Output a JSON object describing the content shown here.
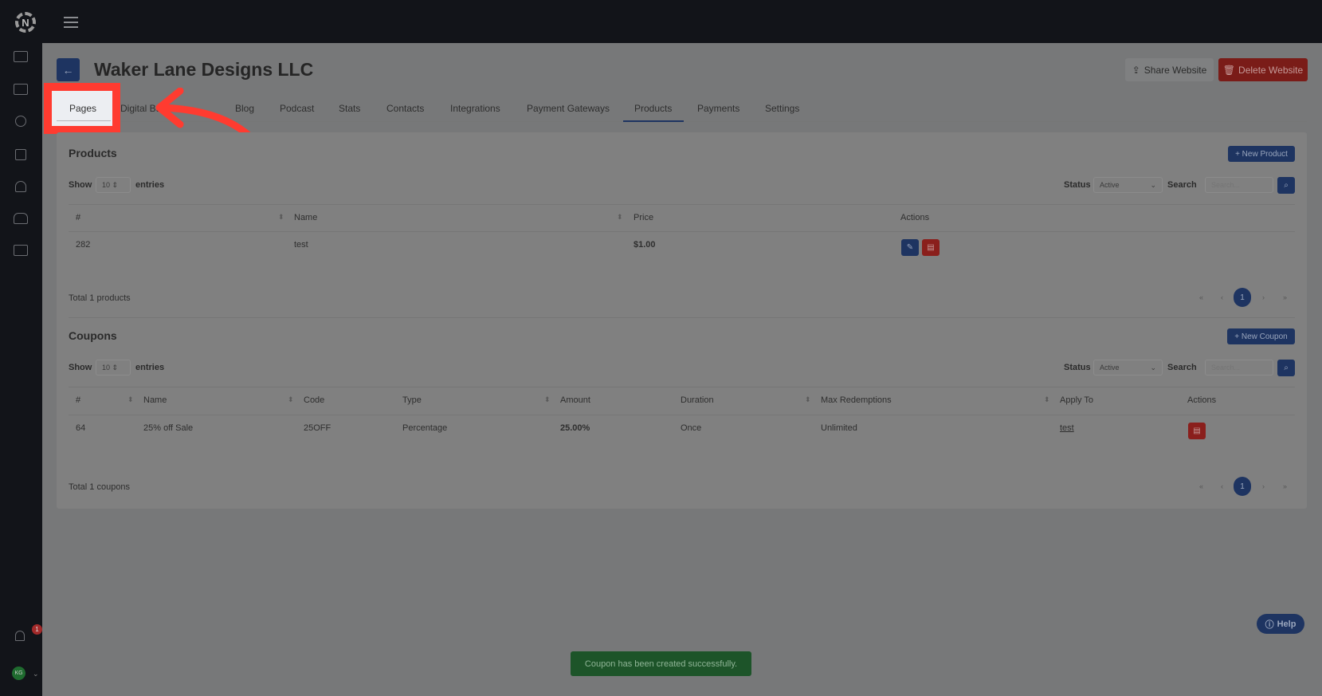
{
  "app": {
    "notifications_count": "1",
    "avatar_initials": "KG"
  },
  "sidebar": {
    "icons": [
      "website-icon",
      "card-icon",
      "gear-icon",
      "apps-icon",
      "add-user-icon",
      "team-icon",
      "video-icon"
    ]
  },
  "header": {
    "title": "Waker Lane Designs LLC",
    "share_label": "Share Website",
    "delete_label": "Delete Website"
  },
  "tabs": [
    {
      "label": "Pages"
    },
    {
      "label": "Digital Bu"
    },
    {
      "label": "Blog"
    },
    {
      "label": "Podcast"
    },
    {
      "label": "Stats"
    },
    {
      "label": "Contacts"
    },
    {
      "label": "Integrations"
    },
    {
      "label": "Payment Gateways"
    },
    {
      "label": "Products",
      "active": true
    },
    {
      "label": "Payments"
    },
    {
      "label": "Settings"
    }
  ],
  "products": {
    "title": "Products",
    "new_label": "+ New Product",
    "show_label": "Show",
    "entries_value": "10",
    "entries_label": "entries",
    "status_label": "Status",
    "status_value": "Active",
    "search_label": "Search",
    "search_placeholder": "Search...",
    "columns": [
      "#",
      "Name",
      "Price",
      "Actions"
    ],
    "rows": [
      {
        "id": "282",
        "name": "test",
        "price": "$1.00"
      }
    ],
    "total": "Total 1 products",
    "page": "1"
  },
  "coupons": {
    "title": "Coupons",
    "new_label": "+ New Coupon",
    "show_label": "Show",
    "entries_value": "10",
    "entries_label": "entries",
    "status_label": "Status",
    "status_value": "Active",
    "search_label": "Search",
    "search_placeholder": "Search...",
    "columns": [
      "#",
      "Name",
      "Code",
      "Type",
      "Amount",
      "Duration",
      "Max Redemptions",
      "Apply To",
      "Actions"
    ],
    "rows": [
      {
        "id": "64",
        "name": "25% off Sale",
        "code": "25OFF",
        "type": "Percentage",
        "amount": "25.00%",
        "duration": "Once",
        "max": "Unlimited",
        "apply": "test"
      }
    ],
    "total": "Total 1 coupons",
    "page": "1"
  },
  "pager": {
    "first": "«",
    "prev": "‹",
    "next": "›",
    "last": "»"
  },
  "help_label": "Help",
  "toast": "Coupon has been created successfully.",
  "colors": {
    "navy": "#1e3461",
    "red": "#8a1f1c",
    "annotation": "#ff3b30",
    "toast": "#1d5429"
  }
}
